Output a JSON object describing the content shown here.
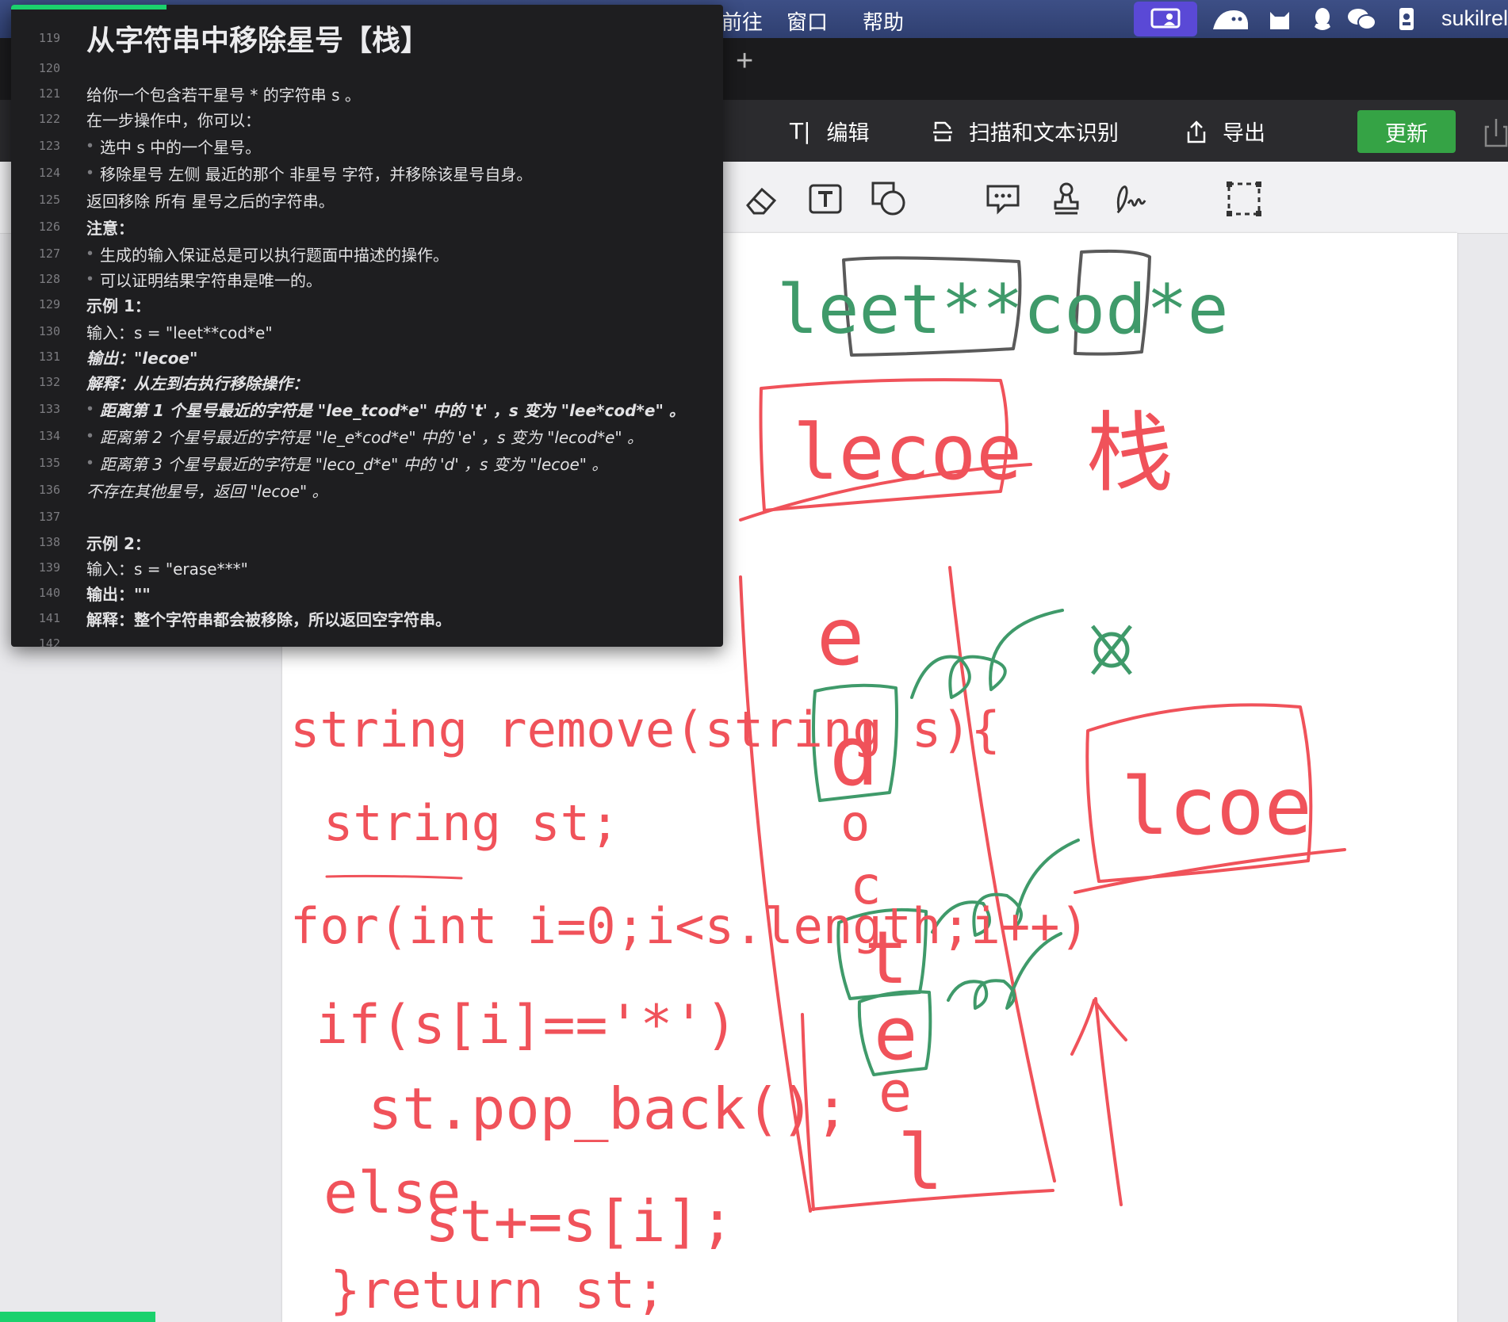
{
  "menubar": {
    "items": [
      "前往",
      "窗口",
      "帮助"
    ],
    "status_icons": [
      "screen-share-icon",
      "ghost-icon",
      "cat-icon",
      "qq-icon",
      "wechat-icon",
      "id-badge-icon"
    ],
    "user": "sukilrel"
  },
  "tabstrip": {
    "add_tab": "+"
  },
  "toolbar": {
    "edit_label": "编辑",
    "edit_icon": "T|",
    "scan_label": "扫描和文本识别",
    "export_label": "导出",
    "update_label": "更新"
  },
  "tools": [
    "eraser-icon",
    "text-box-icon",
    "shapes-icon",
    "comment-icon",
    "stamp-icon",
    "signature-icon",
    "selection-icon"
  ],
  "editor": {
    "lines": [
      {
        "n": "119",
        "text": "从字符串中移除星号【栈】",
        "style": "title"
      },
      {
        "n": "120",
        "text": "",
        "style": ""
      },
      {
        "n": "121",
        "text": "给你一个包含若干星号 * 的字符串 s 。",
        "style": ""
      },
      {
        "n": "122",
        "text": "在一步操作中，你可以：",
        "style": ""
      },
      {
        "n": "123",
        "text": "选中 s 中的一个星号。",
        "style": "bullet"
      },
      {
        "n": "124",
        "text": "移除星号 左侧 最近的那个 非星号 字符，并移除该星号自身。",
        "style": "bullet"
      },
      {
        "n": "125",
        "text": "返回移除 所有 星号之后的字符串。",
        "style": ""
      },
      {
        "n": "126",
        "text": "注意：",
        "style": "b"
      },
      {
        "n": "127",
        "text": "生成的输入保证总是可以执行题面中描述的操作。",
        "style": "bullet"
      },
      {
        "n": "128",
        "text": "可以证明结果字符串是唯一的。",
        "style": "bullet"
      },
      {
        "n": "129",
        "text": "示例 1：",
        "style": "b"
      },
      {
        "n": "130",
        "text": "输入：s = \"leet**cod*e\"",
        "style": ""
      },
      {
        "n": "131",
        "text": "输出：\"lecoe\"",
        "style": "bi"
      },
      {
        "n": "132",
        "text": "解释：从左到右执行移除操作：",
        "style": "bi"
      },
      {
        "n": "133",
        "text": "距离第 1 个星号最近的字符是 \"lee_tcod*e\" 中的 't' ，s 变为 \"lee*cod*e\" 。",
        "style": "bullet bi"
      },
      {
        "n": "134",
        "text": "距离第 2 个星号最近的字符是 \"le_e*cod*e\" 中的 'e' ，s 变为 \"lecod*e\" 。",
        "style": "bullet i"
      },
      {
        "n": "135",
        "text": "距离第 3 个星号最近的字符是 \"leco_d*e\" 中的 'd' ，s 变为 \"lecoe\" 。",
        "style": "bullet i"
      },
      {
        "n": "136",
        "text": "不存在其他星号，返回 \"lecoe\" 。",
        "style": "i"
      },
      {
        "n": "137",
        "text": "",
        "style": ""
      },
      {
        "n": "138",
        "text": "示例 2：",
        "style": "b"
      },
      {
        "n": "139",
        "text": "输入：s = \"erase***\"",
        "style": ""
      },
      {
        "n": "140",
        "text": "输出：\"\"",
        "style": "b"
      },
      {
        "n": "141",
        "text": "解释：整个字符串都会被移除，所以返回空字符串。",
        "style": "b"
      },
      {
        "n": "142",
        "text": "",
        "style": ""
      }
    ]
  },
  "handwriting": {
    "green_example": "leet**cod*e",
    "red_result": "lecoe",
    "red_stack_label": "栈",
    "stack_chars": [
      "e",
      "d",
      "o",
      "c",
      "t",
      "e",
      "e",
      "l"
    ],
    "green_result": "lcoe",
    "code": [
      "string remove(string s){",
      "string st;",
      "for(int i=0;i<s.length;i++)",
      "if(s[i]=='*')",
      "st.pop_back();",
      "else",
      "st+=s[i];",
      "}return st;"
    ]
  },
  "colors": {
    "red_ink": "#f0525a",
    "green_ink": "#3f9a6a",
    "dark_ink": "#555555",
    "update_green": "#35a345",
    "menubar": "#34457a",
    "editor_bg": "#1e1e20"
  }
}
